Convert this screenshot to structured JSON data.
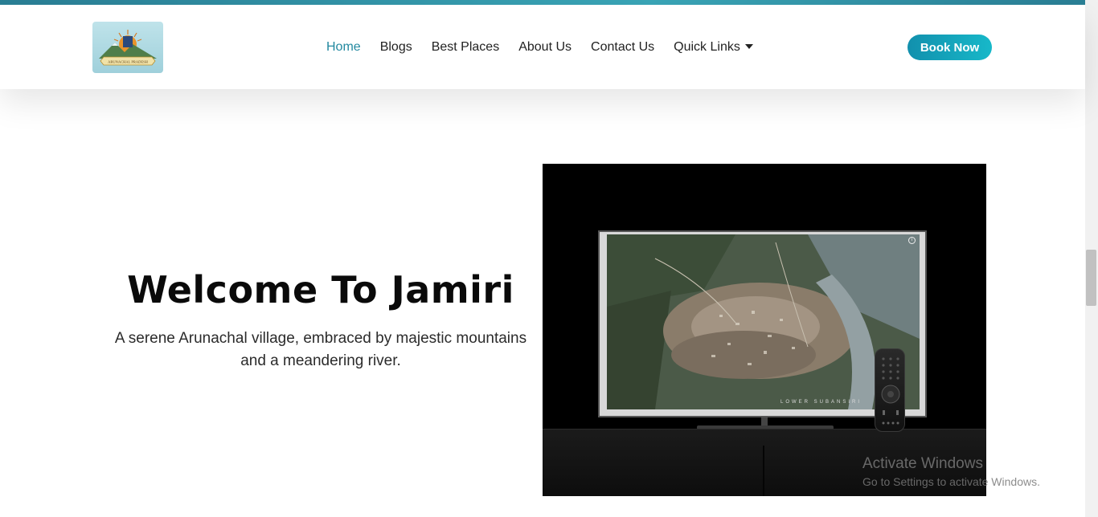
{
  "nav": {
    "items": [
      {
        "label": "Home",
        "active": true
      },
      {
        "label": "Blogs"
      },
      {
        "label": "Best Places"
      },
      {
        "label": "About Us"
      },
      {
        "label": "Contact Us"
      },
      {
        "label": "Quick Links",
        "dropdown": true
      }
    ],
    "cta_label": "Book Now",
    "logo_text": "ARUNACHAL PRADESH"
  },
  "hero": {
    "title": "Welcome To Jamiri",
    "subtitle": "A serene Arunachal village, embraced by majestic mountains and a meandering river."
  },
  "video": {
    "caption": "LOWER SUBANSIRI"
  },
  "watermark": {
    "title": "Activate Windows",
    "subtitle": "Go to Settings to activate Windows."
  },
  "colors": {
    "accent": "#2389a0",
    "button_start": "#1290ad",
    "button_end": "#17b8c9",
    "stripe": "#3aa6b8"
  }
}
